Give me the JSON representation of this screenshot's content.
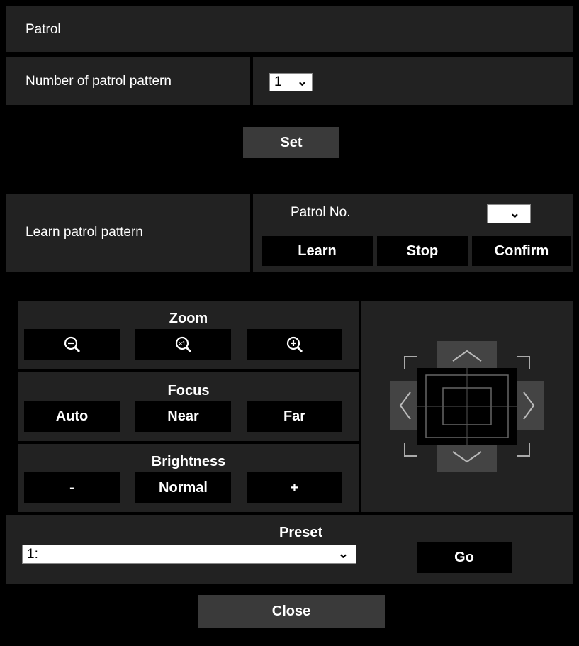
{
  "header": {
    "title": "Patrol"
  },
  "patrol_count": {
    "label": "Number of patrol pattern",
    "selected": "1"
  },
  "set_button": {
    "label": "Set"
  },
  "learn": {
    "label": "Learn patrol pattern",
    "patrol_no_label": "Patrol No.",
    "patrol_no_selected": "",
    "buttons": {
      "learn": "Learn",
      "stop": "Stop",
      "confirm": "Confirm"
    }
  },
  "zoom": {
    "title": "Zoom",
    "icons": [
      "zoom-out-icon",
      "zoom-reset-x1-icon",
      "zoom-in-icon"
    ]
  },
  "focus": {
    "title": "Focus",
    "buttons": {
      "auto": "Auto",
      "near": "Near",
      "far": "Far"
    }
  },
  "brightness": {
    "title": "Brightness",
    "buttons": {
      "minus": "-",
      "normal": "Normal",
      "plus": "+"
    }
  },
  "ptz_pad": {
    "icons": [
      "arrow-up-icon",
      "arrow-down-icon",
      "arrow-left-icon",
      "arrow-right-icon",
      "corner-icons",
      "center-target-icon"
    ]
  },
  "preset": {
    "title": "Preset",
    "selected": "1:",
    "go_label": "Go"
  },
  "close_button": {
    "label": "Close"
  }
}
